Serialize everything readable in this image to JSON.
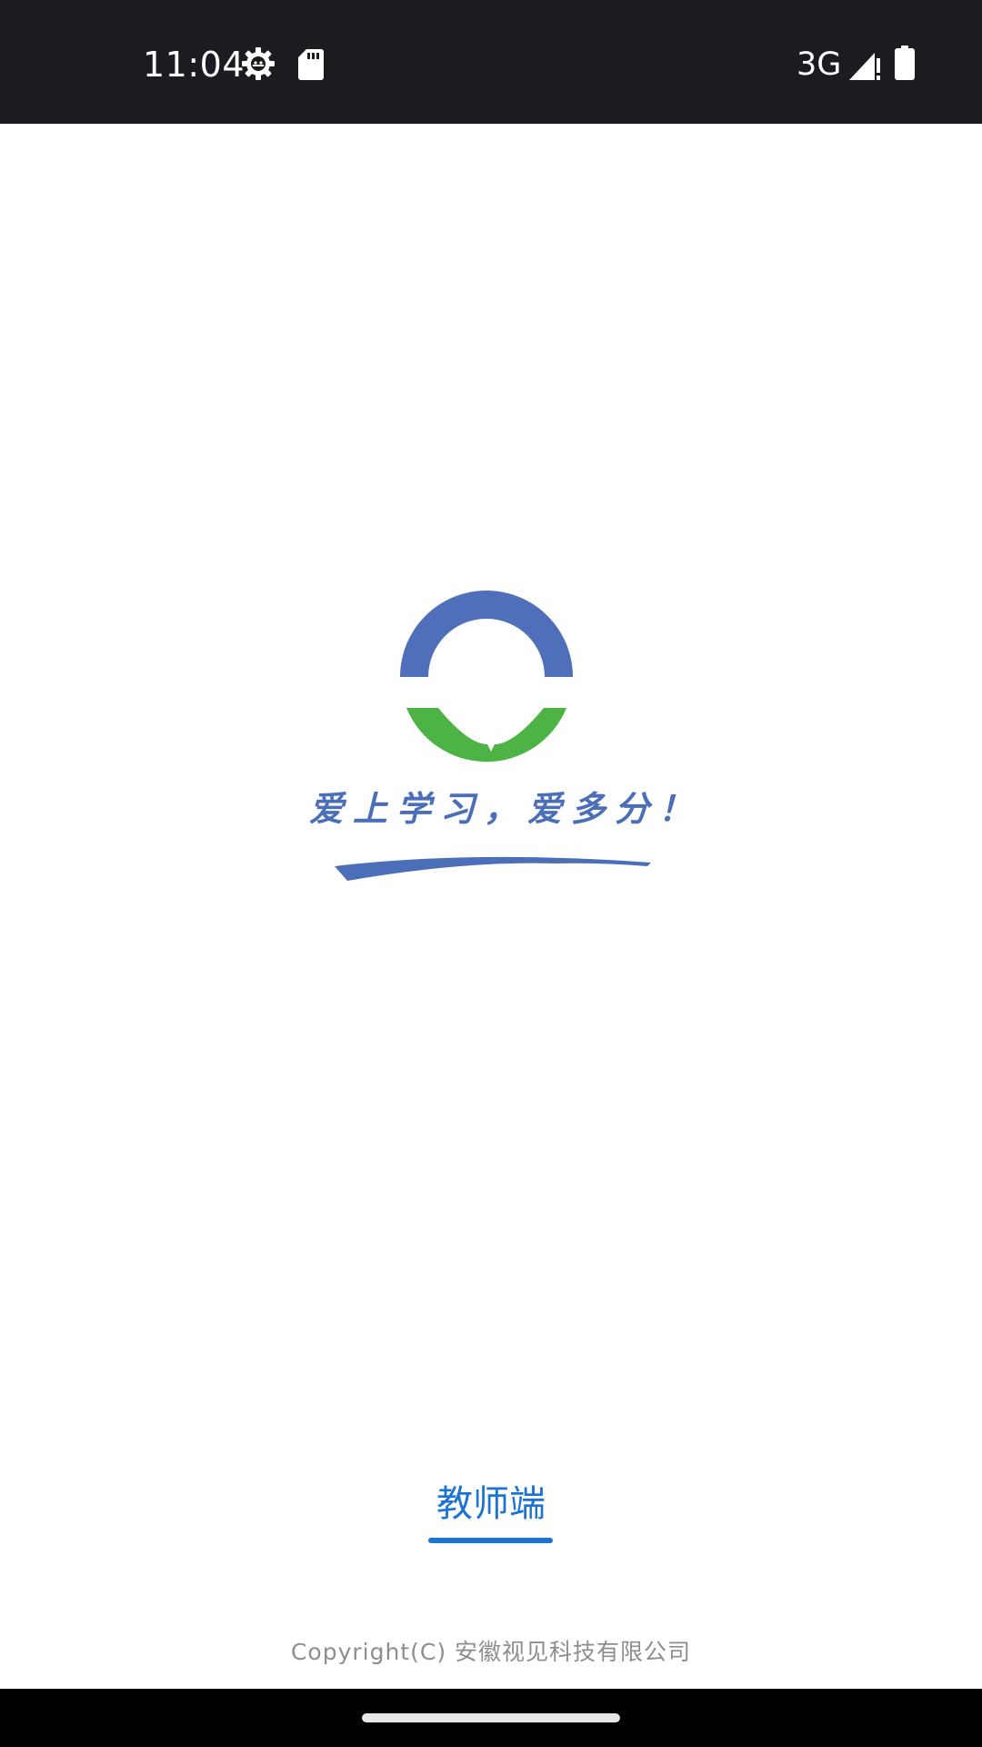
{
  "status_bar": {
    "time": "11:04",
    "network": "3G",
    "icons": [
      "settings-gear-icon",
      "sd-card-icon",
      "signal-icon",
      "battery-icon"
    ]
  },
  "splash": {
    "slogan": "爱上学习，爱多分！",
    "logo_colors": {
      "top_ring": "#4f6fbb",
      "bottom_ring": "#4cb344",
      "brush": "#4a6fb8"
    }
  },
  "role_tab": {
    "label": "教师端",
    "selected": true,
    "accent_color": "#1b74d4"
  },
  "footer": {
    "copyright": "Copyright(C) 安徽视见科技有限公司"
  }
}
